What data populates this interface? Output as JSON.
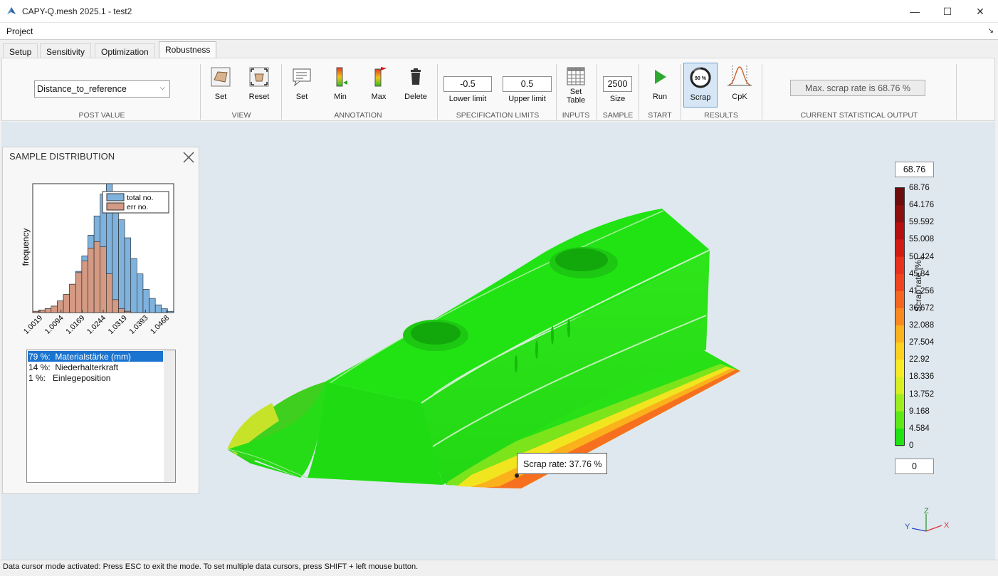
{
  "window": {
    "title": "CAPY-Q.mesh 2025.1 - test2",
    "minimize": "—",
    "maximize": "☐",
    "close": "✕"
  },
  "menu": {
    "project": "Project",
    "arrow": "↘"
  },
  "tabs": [
    {
      "label": "Setup"
    },
    {
      "label": "Sensitivity"
    },
    {
      "label": "Optimization"
    },
    {
      "label": "Robustness",
      "active": true
    }
  ],
  "ribbon": {
    "post_value": {
      "selected": "Distance_to_reference",
      "group": "POST VALUE"
    },
    "view": {
      "set": "Set",
      "reset": "Reset",
      "group": "VIEW"
    },
    "annotation": {
      "set": "Set",
      "min": "Min",
      "max": "Max",
      "delete": "Delete",
      "group": "ANNOTATION"
    },
    "spec_limits": {
      "lower_value": "-0.5",
      "lower_label": "Lower limit",
      "upper_value": "0.5",
      "upper_label": "Upper limit",
      "group": "SPECIFICATION LIMITS"
    },
    "inputs": {
      "set_table": "Set",
      "set_table_2": "Table",
      "group": "INPUTS"
    },
    "sample": {
      "size_value": "2500",
      "size_label": "Size",
      "group": "SAMPLE"
    },
    "start": {
      "run": "Run",
      "group": "START"
    },
    "results": {
      "scrap": "Scrap",
      "scrap_badge": "90 %",
      "cpk": "CpK",
      "group": "RESULTS"
    },
    "statistical_output": {
      "text": "Max. scrap rate is 68.76 %",
      "group": "CURRENT STATISTICAL OUTPUT"
    }
  },
  "sample_distribution": {
    "title": "SAMPLE DISTRIBUTION",
    "ylabel": "frequency",
    "legend_total": "total no.",
    "legend_err": "err no.",
    "x_ticks": [
      "1.0019",
      "1.0094",
      "1.0169",
      "1.0244",
      "1.0319",
      "1.0393",
      "1.0468"
    ],
    "total_counts": [
      1,
      2,
      3,
      5,
      9,
      14,
      22,
      32,
      44,
      60,
      75,
      92,
      100,
      88,
      72,
      58,
      42,
      30,
      18,
      11,
      6,
      3,
      1
    ],
    "err_counts": [
      1,
      2,
      3,
      5,
      9,
      14,
      22,
      31,
      40,
      50,
      55,
      51,
      30,
      10,
      3,
      1,
      0,
      0,
      0,
      0,
      0,
      0,
      0
    ],
    "color_total": "#7fb2dd",
    "color_err": "#d49a83"
  },
  "factors": [
    {
      "percent": "79 %:",
      "name": "Materialstärke (mm)",
      "selected": true
    },
    {
      "percent": "14 %:",
      "name": "Niederhalterkraft",
      "selected": false
    },
    {
      "percent": "1 %:",
      "name": "Einlegeposition",
      "selected": false
    }
  ],
  "colorbar": {
    "max_box": "68.76",
    "min_box": "0",
    "title": "Scrap rate [%]",
    "ticks": [
      "68.76",
      "64.176",
      "59.592",
      "55.008",
      "50.424",
      "45.84",
      "41.256",
      "36.672",
      "32.088",
      "27.504",
      "22.92",
      "18.336",
      "13.752",
      "9.168",
      "4.584",
      "0"
    ],
    "colors": [
      "#6e0b0b",
      "#8c0e0e",
      "#b50f0f",
      "#d41b13",
      "#e8301c",
      "#f2431f",
      "#f6661f",
      "#fa8a1e",
      "#fbb21c",
      "#fcd21f",
      "#f7ec24",
      "#d8f022",
      "#9cef1d",
      "#5cea17",
      "#1fe312"
    ]
  },
  "tooltip": {
    "text": "Scrap rate: 37.76 %"
  },
  "axis_triad": {
    "x": "X",
    "y": "Y",
    "z": "Z"
  },
  "status": {
    "text": "Data cursor mode activated: Press ESC to exit the mode. To set multiple data cursors, press SHIFT + left mouse button."
  }
}
